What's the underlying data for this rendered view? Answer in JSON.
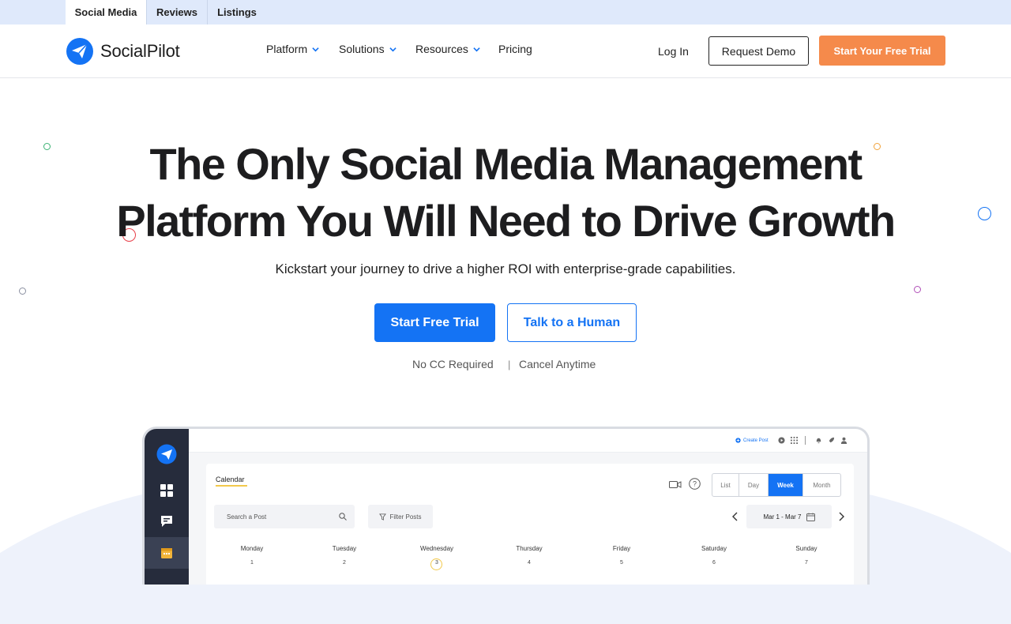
{
  "topbar": {
    "tabs": [
      {
        "label": "Social Media",
        "active": true
      },
      {
        "label": "Reviews",
        "active": false
      },
      {
        "label": "Listings",
        "active": false
      }
    ]
  },
  "nav": {
    "brand": "SocialPilot",
    "menu": [
      {
        "label": "Platform",
        "has_dropdown": true
      },
      {
        "label": "Solutions",
        "has_dropdown": true
      },
      {
        "label": "Resources",
        "has_dropdown": true
      },
      {
        "label": "Pricing",
        "has_dropdown": false
      }
    ],
    "login_label": "Log In",
    "demo_label": "Request Demo",
    "trial_label": "Start Your Free Trial"
  },
  "hero": {
    "title_line1": "The Only Social Media Management",
    "title_line2": "Platform You Will Need to Drive Growth",
    "subtitle": "Kickstart your journey to drive a higher ROI with enterprise-grade capabilities.",
    "primary_cta": "Start Free Trial",
    "secondary_cta": "Talk to a Human",
    "note_left": "No CC Required",
    "note_sep": "|",
    "note_right": "Cancel Anytime"
  },
  "app": {
    "create_post": "Create Post",
    "calendar_label": "Calendar",
    "views": [
      {
        "label": "List",
        "active": false
      },
      {
        "label": "Day",
        "active": false
      },
      {
        "label": "Week",
        "active": true
      },
      {
        "label": "Month",
        "active": false
      }
    ],
    "search_placeholder": "Search a Post",
    "filter_label": "Filter Posts",
    "date_range": "Mar 1 - Mar 7",
    "days": [
      {
        "name": "Monday",
        "num": "1"
      },
      {
        "name": "Tuesday",
        "num": "2"
      },
      {
        "name": "Wednesday",
        "num": "3"
      },
      {
        "name": "Thursday",
        "num": "4"
      },
      {
        "name": "Friday",
        "num": "5"
      },
      {
        "name": "Saturday",
        "num": "6"
      },
      {
        "name": "Sunday",
        "num": "7"
      }
    ],
    "today_index": 2
  },
  "colors": {
    "brand_blue": "#1473f4",
    "orange": "#f58a4b",
    "topbar_bg": "#dfe9fb",
    "sidebar_dark": "#262c3c"
  }
}
